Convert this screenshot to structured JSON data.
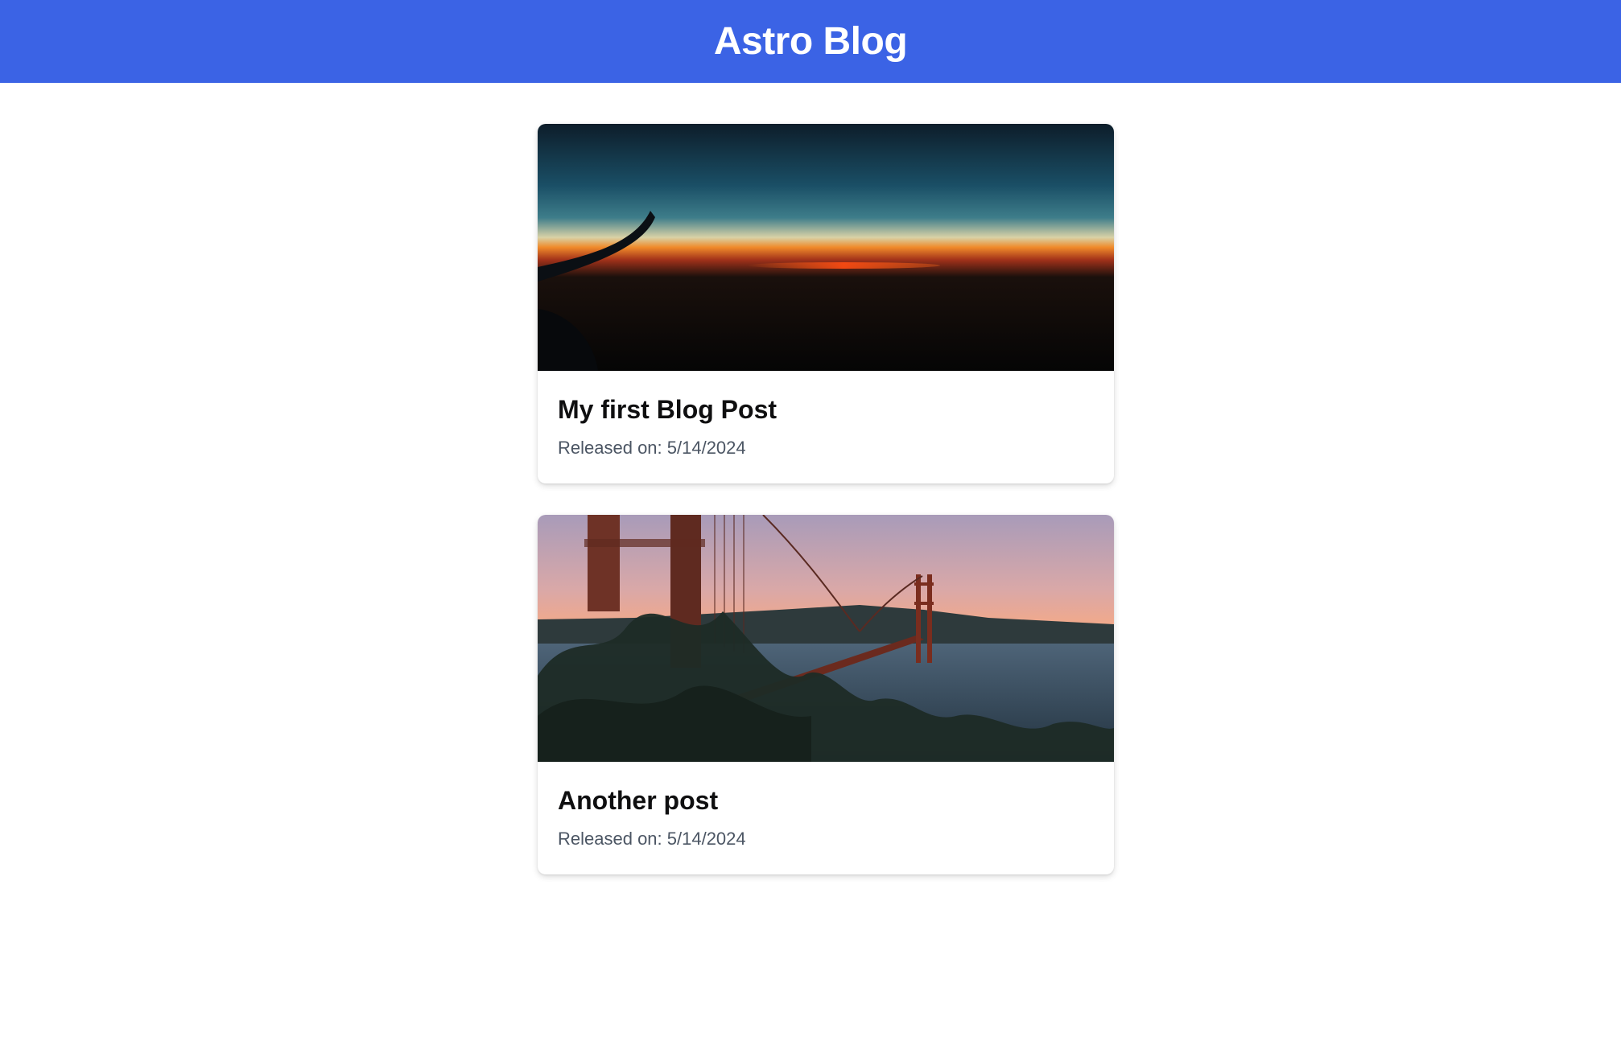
{
  "header": {
    "title": "Astro Blog",
    "background": "#3b63e5"
  },
  "posts": [
    {
      "title": "My first Blog Post",
      "date_label": "Released on: 5/14/2024",
      "image": "sunset-from-airplane-window-photo"
    },
    {
      "title": "Another post",
      "date_label": "Released on: 5/14/2024",
      "image": "golden-gate-bridge-at-dusk-photo"
    }
  ]
}
